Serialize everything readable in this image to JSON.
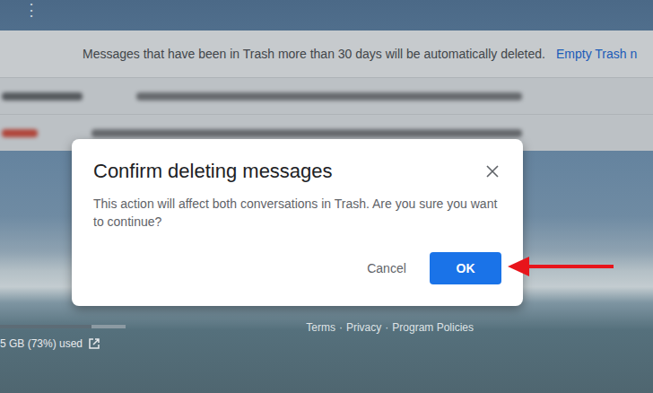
{
  "menu_icon": "⋮",
  "banner": {
    "text": "Messages that have been in Trash more than 30 days will be automatically deleted.",
    "link": "Empty Trash n"
  },
  "storage": {
    "text": "5 GB (73%) used",
    "level": 0.73
  },
  "footer": {
    "links": [
      "Terms",
      "Privacy",
      "Program Policies"
    ],
    "separator": "·"
  },
  "dialog": {
    "title": "Confirm deleting messages",
    "message": "This action will affect both conversations in Trash. Are you sure you want to continue?",
    "buttons": [
      {
        "label": "Cancel",
        "primary": false
      },
      {
        "label": "OK",
        "primary": true
      }
    ]
  }
}
